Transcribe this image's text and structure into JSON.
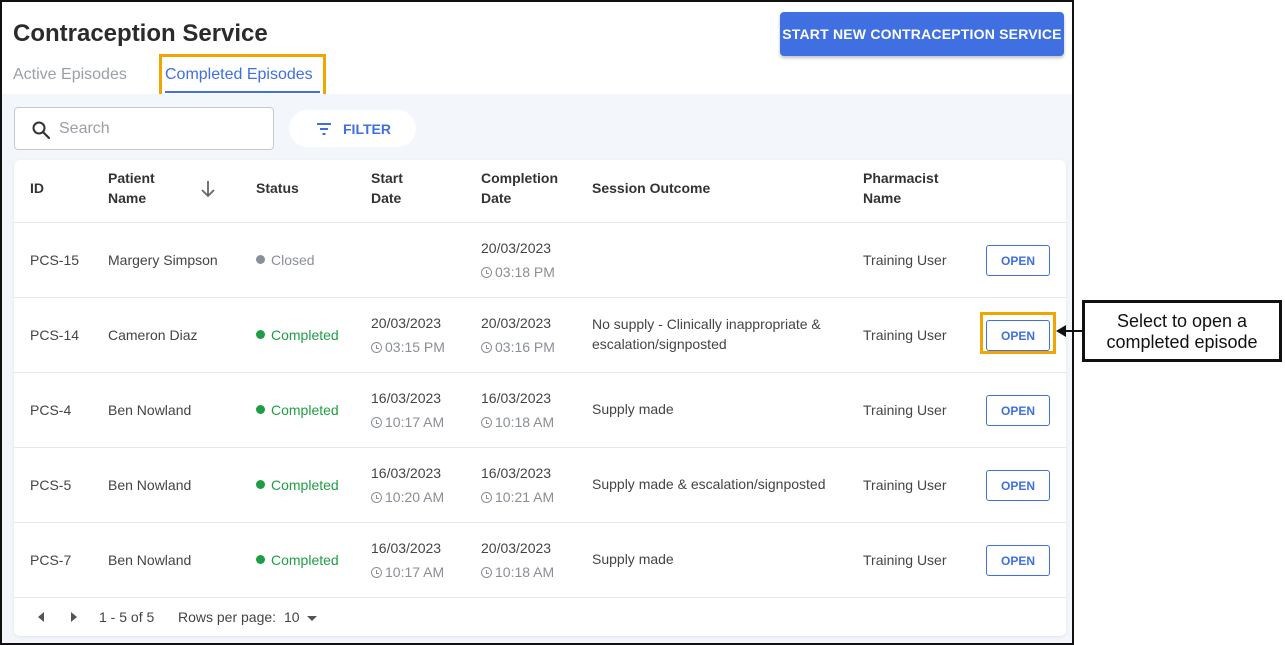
{
  "header": {
    "title": "Contraception Service",
    "start_button_label": "START NEW CONTRACEPTION SERVICE"
  },
  "tabs": [
    {
      "label": "Active Episodes",
      "active": false
    },
    {
      "label": "Completed Episodes",
      "active": true
    }
  ],
  "toolbar": {
    "search_placeholder": "Search",
    "search_value": "",
    "filter_label": "FILTER"
  },
  "table": {
    "columns": {
      "id": "ID",
      "patient_name": [
        "Patient",
        "Name"
      ],
      "status": "Status",
      "start_date": [
        "Start",
        "Date"
      ],
      "completion_date": [
        "Completion",
        "Date"
      ],
      "session_outcome": "Session Outcome",
      "pharmacist_name": [
        "Pharmacist",
        "Name"
      ]
    },
    "sort_column": "patient_name",
    "sort_direction": "descending",
    "open_label": "OPEN",
    "rows": [
      {
        "id": "PCS-15",
        "patient": "Margery Simpson",
        "status": "Closed",
        "start_date": "",
        "start_time": "",
        "completion_date": "20/03/2023",
        "completion_time": "03:18 PM",
        "outcome": "",
        "pharmacist": "Training User"
      },
      {
        "id": "PCS-14",
        "patient": "Cameron Diaz",
        "status": "Completed",
        "start_date": "20/03/2023",
        "start_time": "03:15 PM",
        "completion_date": "20/03/2023",
        "completion_time": "03:16 PM",
        "outcome": "No supply - Clinically inappropriate & escalation/signposted",
        "pharmacist": "Training User"
      },
      {
        "id": "PCS-4",
        "patient": "Ben Nowland",
        "status": "Completed",
        "start_date": "16/03/2023",
        "start_time": "10:17 AM",
        "completion_date": "16/03/2023",
        "completion_time": "10:18 AM",
        "outcome": "Supply made",
        "pharmacist": "Training User"
      },
      {
        "id": "PCS-5",
        "patient": "Ben Nowland",
        "status": "Completed",
        "start_date": "16/03/2023",
        "start_time": "10:20 AM",
        "completion_date": "16/03/2023",
        "completion_time": "10:21 AM",
        "outcome": "Supply made & escalation/signposted",
        "pharmacist": "Training User"
      },
      {
        "id": "PCS-7",
        "patient": "Ben Nowland",
        "status": "Completed",
        "start_date": "16/03/2023",
        "start_time": "10:17 AM",
        "completion_date": "20/03/2023",
        "completion_time": "10:18 AM",
        "outcome": "Supply made",
        "pharmacist": "Training User"
      }
    ]
  },
  "pagination": {
    "range": "1 - 5 of 5",
    "rows_per_page_label": "Rows per page:",
    "rows_per_page_value": "10"
  },
  "annotation": {
    "callout_line1": "Select to open a",
    "callout_line2": "completed episode"
  },
  "colors": {
    "accent": "#3f6fe0",
    "completed": "#1e9e44",
    "closed": "#8a8f96",
    "highlight": "#f0a500"
  }
}
